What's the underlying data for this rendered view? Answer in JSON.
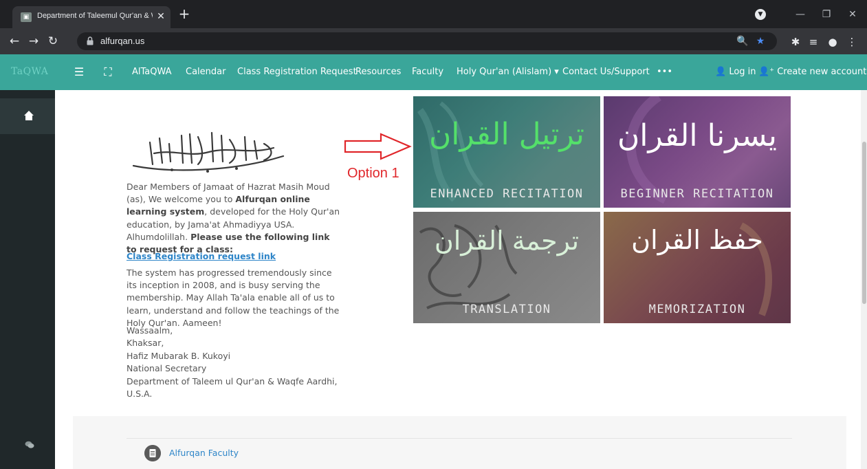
{
  "browser": {
    "tab_title": "Department of Taleemul Qur'an & Waqf",
    "url": "alfurqan.us",
    "new_tab_glyph": "+",
    "close_glyph": "✕",
    "window_minimize": "—",
    "window_maximize": "❐",
    "window_close": "✕"
  },
  "navbar": {
    "brand": "TaQWA",
    "items": [
      {
        "label": "AlTaQWA"
      },
      {
        "label": "Calendar"
      },
      {
        "label": "Class Registration Request"
      },
      {
        "label": "Resources"
      },
      {
        "label": "Faculty"
      },
      {
        "label": "Holy Qur'an (Alislam) ▾"
      },
      {
        "label": "Contact Us/Support"
      },
      {
        "label": "•••"
      }
    ],
    "login": "Log in",
    "create_account": "Create new account"
  },
  "main": {
    "intro_1": "Dear Members of Jamaat of Hazrat Masih Moud (as), We welcome you to ",
    "intro_bold_1": "Alfurqan online learning system",
    "intro_2": ", developed for the Holy Qur'an education, by Jama'at Ahmadiyya USA. Alhumdolillah. ",
    "intro_bold_2": "Please use the following link to request for a class:",
    "registration_link": "Class Registration request link",
    "paragraph_2": "The system has progressed tremendously since its inception in 2008, and is busy serving the membership. May Allah Ta'ala enable all of us to learn, understand and follow the teachings of the Holy Qur'an. Aameen!",
    "signoff": [
      "Wassaalm,",
      "Khaksar,",
      "Hafiz Mubarak B. Kukoyi",
      "National Secretary",
      "Department of Taleem ul Qur'an & Waqfe Aardhi,",
      "U.S.A."
    ],
    "annotation": "Option 1",
    "tiles": [
      {
        "arabic": "ترتيل القران",
        "caption": "ENHANCED RECITATION"
      },
      {
        "arabic": "يسرنا القران",
        "caption": "BEGINNER RECITATION"
      },
      {
        "arabic": "ترجمة القران",
        "caption": "TRANSLATION"
      },
      {
        "arabic": "حفظ القران",
        "caption": "MEMORIZATION"
      }
    ],
    "footer_link": "Alfurqan Faculty"
  },
  "colors": {
    "navbar": "#3aa69a",
    "drawer": "#20282a",
    "link": "#2e85c8",
    "annotation": "#e0262a"
  }
}
